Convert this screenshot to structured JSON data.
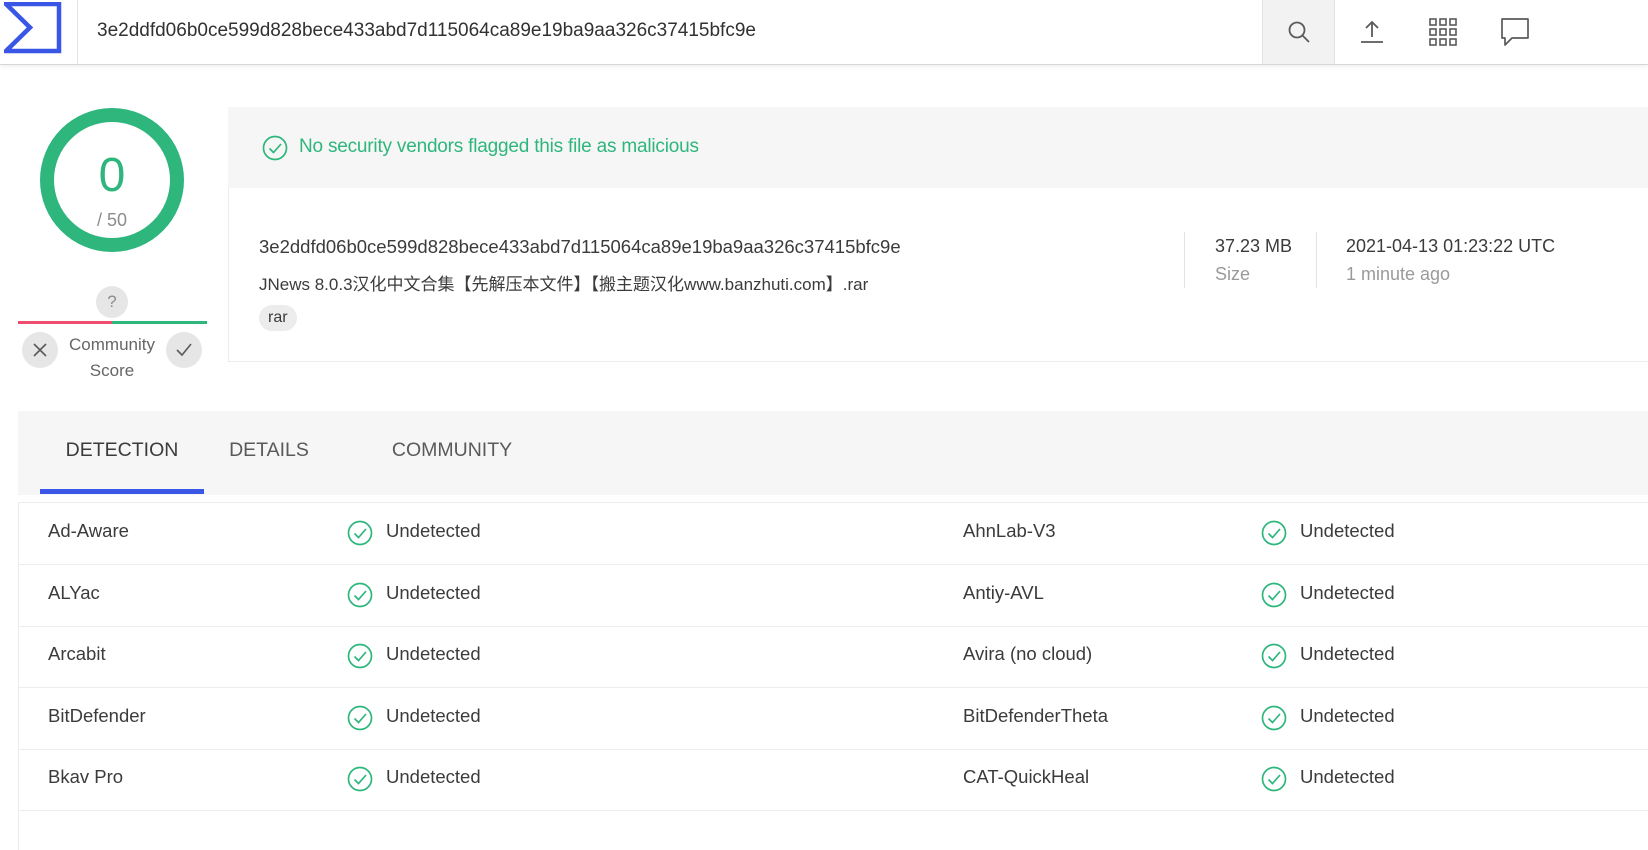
{
  "search": {
    "value": "3e2ddfd06b0ce599d828bece433abd7d115064ca89e19ba9aa326c37415bfc9e"
  },
  "score": {
    "detections": "0",
    "total": "/ 50"
  },
  "community_score": {
    "value": "?",
    "label_line1": "Community",
    "label_line2": "Score"
  },
  "banner": {
    "text": "No security vendors flagged this file as malicious"
  },
  "file": {
    "hash": "3e2ddfd06b0ce599d828bece433abd7d115064ca89e19ba9aa326c37415bfc9e",
    "name": "JNews 8.0.3汉化中文合集【先解压本文件】【搬主题汉化www.banzhuti.com】.rar",
    "tag": "rar",
    "size": "37.23 MB",
    "size_label": "Size",
    "date": "2021-04-13 01:23:22 UTC",
    "date_relative": "1 minute ago"
  },
  "tabs": [
    {
      "label": "DETECTION"
    },
    {
      "label": "DETAILS"
    },
    {
      "label": "COMMUNITY"
    }
  ],
  "detections": [
    {
      "left_engine": "Ad-Aware",
      "left_result": "Undetected",
      "right_engine": "AhnLab-V3",
      "right_result": "Undetected"
    },
    {
      "left_engine": "ALYac",
      "left_result": "Undetected",
      "right_engine": "Antiy-AVL",
      "right_result": "Undetected"
    },
    {
      "left_engine": "Arcabit",
      "left_result": "Undetected",
      "right_engine": "Avira (no cloud)",
      "right_result": "Undetected"
    },
    {
      "left_engine": "BitDefender",
      "left_result": "Undetected",
      "right_engine": "BitDefenderTheta",
      "right_result": "Undetected"
    },
    {
      "left_engine": "Bkav Pro",
      "left_result": "Undetected",
      "right_engine": "CAT-QuickHeal",
      "right_result": "Undetected"
    }
  ],
  "colors": {
    "accent": "#3a56e6",
    "clean": "#2eb67d",
    "malicious": "#ef4d6e"
  },
  "icons": [
    "logo-icon",
    "search-icon",
    "upload-icon",
    "apps-grid-icon",
    "chat-icon",
    "check-circle-icon",
    "close-icon",
    "check-icon"
  ]
}
